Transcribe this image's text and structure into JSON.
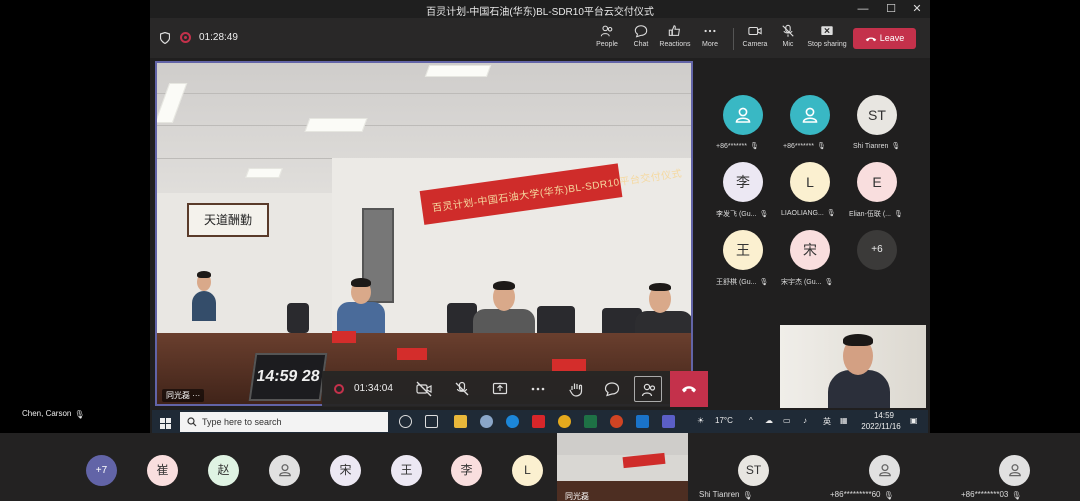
{
  "window": {
    "title": "百灵计划-中国石油(华东)BL-SDR10平台云交付仪式"
  },
  "toolbar": {
    "timer": "01:28:49",
    "people": "People",
    "chat": "Chat",
    "reactions": "Reactions",
    "more": "More",
    "camera": "Camera",
    "mic": "Mic",
    "share": "Stop sharing",
    "leave": "Leave"
  },
  "video": {
    "banner": "百灵计划-中国石油大学(华东)BL-SDR10平台交付仪式",
    "calligraphy": "天道酬勤",
    "laptop_clock": "14:59 28",
    "presenter": "同光磊 ···"
  },
  "controls": {
    "timer": "01:34:04"
  },
  "participants": [
    {
      "name": "+86*******",
      "initial": "",
      "bg": "#39b8c4"
    },
    {
      "name": "+86*******",
      "initial": "",
      "bg": "#39b8c4"
    },
    {
      "name": "Shi Tianren",
      "initial": "ST",
      "bg": "#e8e6e1"
    },
    {
      "name": "李发飞 (Gu...",
      "initial": "李",
      "bg": "#ece8f3"
    },
    {
      "name": "LIAOLIANG...",
      "initial": "L",
      "bg": "#fbf0d0"
    },
    {
      "name": "Elian-伍联 (...",
      "initial": "E",
      "bg": "#f9dede"
    },
    {
      "name": "王舒棋 (Gu...",
      "initial": "王",
      "bg": "#fbf0d0"
    },
    {
      "name": "宋宇杰 (Gu...",
      "initial": "宋",
      "bg": "#f9dede"
    },
    {
      "name": "",
      "initial": "+6",
      "bg": "#3b3a39"
    }
  ],
  "taskbar": {
    "search": "Type here to search",
    "temp": "17°C",
    "lang": "英",
    "time": "14:59",
    "date": "2022/11/16"
  },
  "left_label": "Chen, Carson",
  "bottom": {
    "avatars": [
      {
        "initial": "+7",
        "bg": "#6264a7"
      },
      {
        "initial": "崔",
        "bg": "#f9dede"
      },
      {
        "initial": "赵",
        "bg": "#dff3e3"
      },
      {
        "initial": "",
        "bg": "#e1e1e1"
      },
      {
        "initial": "宋",
        "bg": "#ece8f3"
      },
      {
        "initial": "王",
        "bg": "#ece8f3"
      },
      {
        "initial": "李",
        "bg": "#f9dede"
      },
      {
        "initial": "L",
        "bg": "#fbf0d0"
      }
    ],
    "thumb_name": "同光磊",
    "st_initial": "ST",
    "st_name": "Shi Tianren",
    "p1_name": "+86*********60",
    "p2_name": "+86********03"
  }
}
